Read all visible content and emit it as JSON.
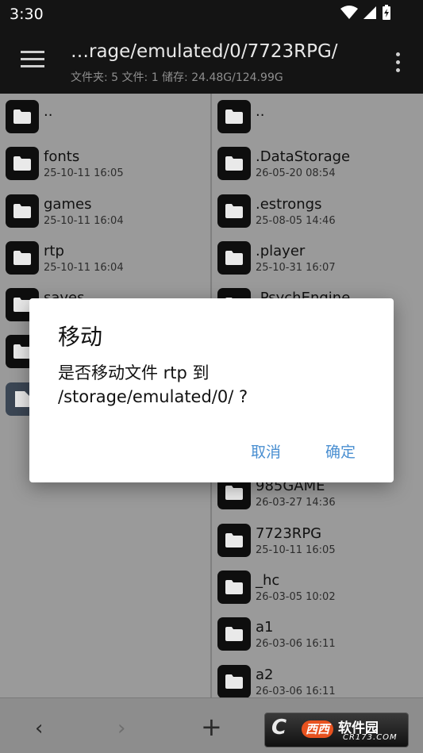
{
  "status": {
    "time": "3:30"
  },
  "header": {
    "path": "…rage/emulated/0/7723RPG/",
    "stats": "文件夹: 5  文件: 1  储存: 24.48G/124.99G"
  },
  "left_pane": [
    {
      "name": "..",
      "date": ""
    },
    {
      "name": "fonts",
      "date": "25-10-11 16:05"
    },
    {
      "name": "games",
      "date": "25-10-11 16:04"
    },
    {
      "name": "rtp",
      "date": "25-10-11 16:04"
    },
    {
      "name": "saves",
      "date": ""
    },
    {
      "name": "",
      "date": ""
    },
    {
      "name": "",
      "date": "",
      "file": true
    }
  ],
  "right_pane": [
    {
      "name": "..",
      "date": ""
    },
    {
      "name": ".DataStorage",
      "date": "26-05-20 08:54"
    },
    {
      "name": ".estrongs",
      "date": "25-08-05 14:46"
    },
    {
      "name": ".player",
      "date": "25-10-31 16:07"
    },
    {
      "name": ".PsychEngine",
      "date": ""
    },
    {
      "name": "",
      "date": ""
    },
    {
      "name": "",
      "date": ""
    },
    {
      "name": "",
      "date": ""
    },
    {
      "name": "985GAME",
      "date": "26-03-27 14:36"
    },
    {
      "name": "7723RPG",
      "date": "25-10-11 16:05"
    },
    {
      "name": "_hc",
      "date": "26-03-05 10:02"
    },
    {
      "name": "a1",
      "date": "26-03-06 16:11"
    },
    {
      "name": "a2",
      "date": "26-03-06 16:11"
    }
  ],
  "dialog": {
    "title": "移动",
    "message": "是否移动文件 rtp 到 /storage/emulated/0/ ?",
    "cancel": "取消",
    "ok": "确定"
  },
  "bottom": {
    "back": "‹",
    "forward": "›",
    "add": "+"
  },
  "watermark": {
    "logo": "C",
    "badge": "西西",
    "cn": "软件园",
    "en": "CR173.COM"
  },
  "colors": {
    "accent": "#4a8fd1",
    "appbar": "#141414",
    "folder": "#0e0e0e"
  },
  "icons": {
    "folder": "folder-icon",
    "file": "file-icon",
    "menu": "menu-icon",
    "more": "more-vert-icon"
  }
}
